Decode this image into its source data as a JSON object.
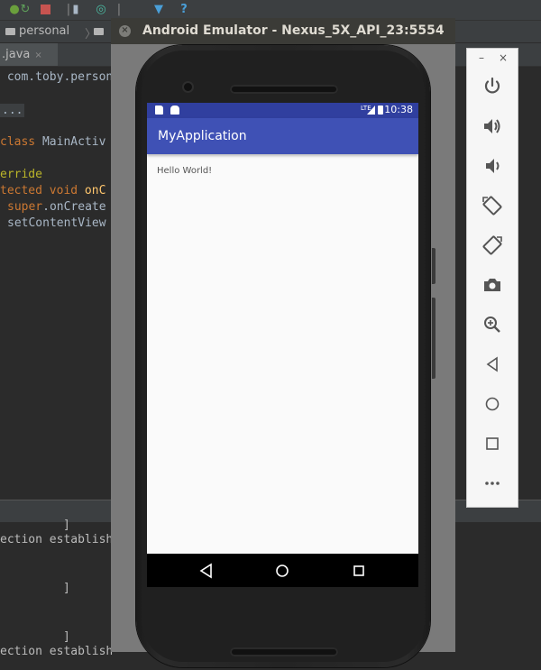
{
  "ide": {
    "breadcrumb": [
      "personal",
      ""
    ],
    "file_tab": ".java",
    "file_tab_close": "×",
    "code_lines": {
      "l1_pkg": " com.toby.person",
      "l2_dots": "...",
      "l3_kw": "class ",
      "l3_cls": "MainActiv",
      "l4_an": "erride",
      "l5_kw": "tected void ",
      "l5_mth": "onC",
      "l6_kw": "super",
      "l6_rest": ".onCreate",
      "l7": "setContentView"
    },
    "log_lines": [
      "]",
      "ection establish",
      "]",
      "]",
      "ection establish"
    ]
  },
  "emulator": {
    "title": "Android Emulator - Nexus_5X_API_23:5554",
    "close_label": "×",
    "status_time": "10:38",
    "status_network": "LTE",
    "app_title": "MyApplication",
    "content_text": "Hello World!"
  },
  "sidebar": {
    "minimize": "–",
    "close": "×",
    "buttons": [
      "power-icon",
      "volume-up-icon",
      "volume-down-icon",
      "rotate-left-icon",
      "rotate-right-icon",
      "camera-icon",
      "zoom-icon",
      "back-icon",
      "home-icon",
      "overview-icon",
      "more-icon"
    ]
  },
  "colors": {
    "primary": "#3f51b5",
    "primary_dark": "#303f9f",
    "ide_bg": "#2b2b2b",
    "keyword": "#cc7832"
  }
}
